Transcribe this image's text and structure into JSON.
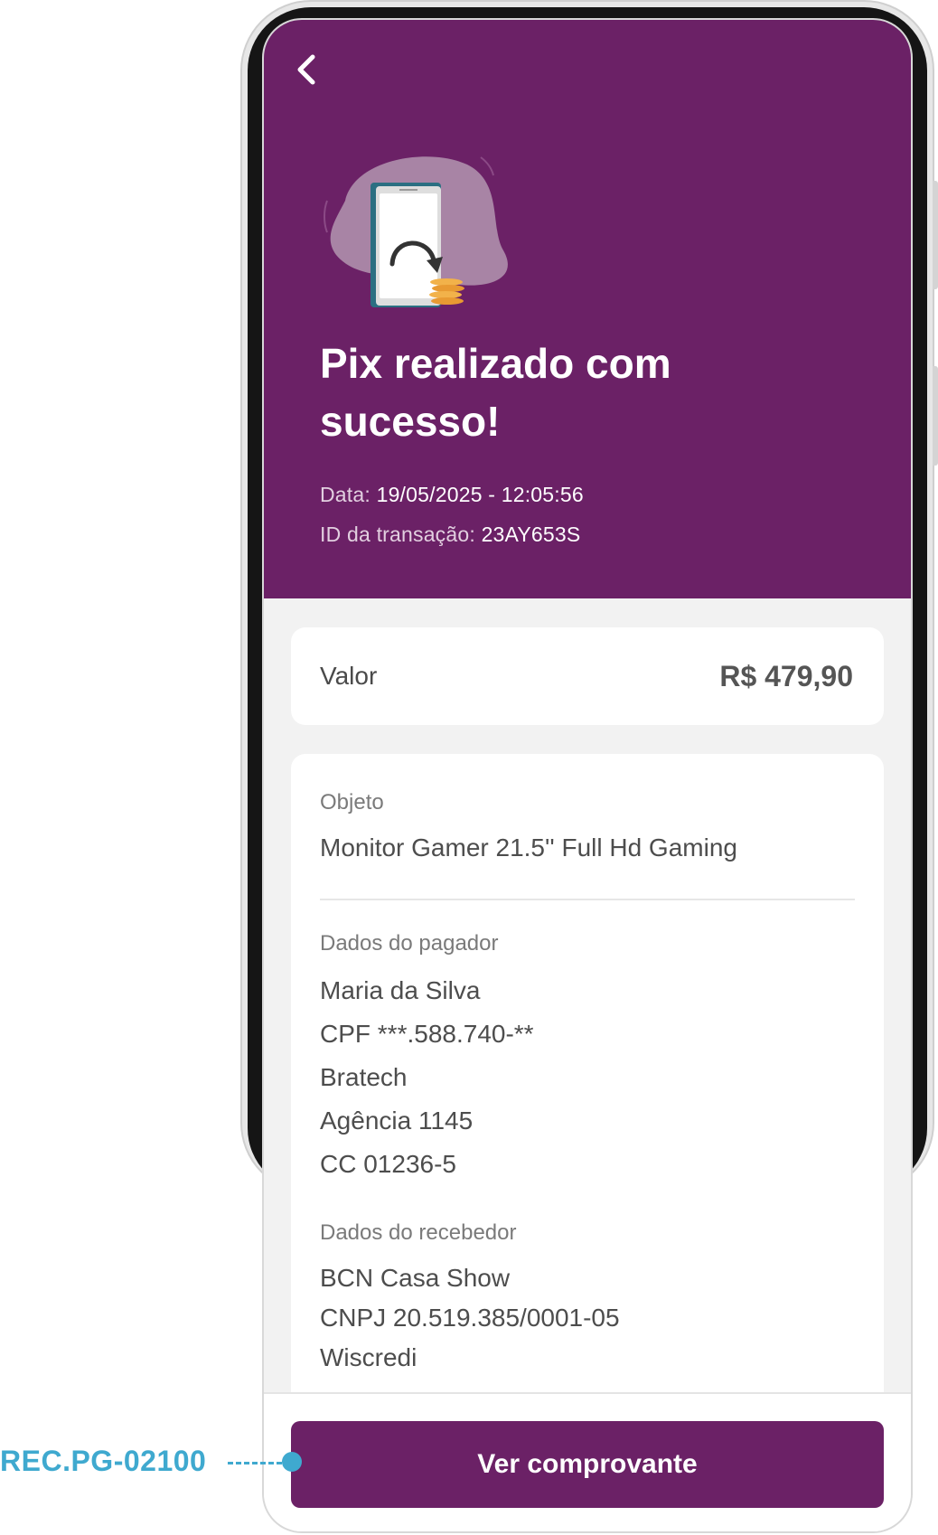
{
  "header": {
    "back_icon": "chevron-left-icon",
    "illustration_icon": "phone-transfer-coins-icon",
    "title": "Pix realizado com sucesso!",
    "date_label": "Data:",
    "date_value": "19/05/2025 - 12:05:56",
    "transaction_label": "ID da transação:",
    "transaction_value": "23AY653S"
  },
  "valor": {
    "label": "Valor",
    "amount": "R$ 479,90"
  },
  "details": {
    "object_label": "Objeto",
    "object_value": "Monitor Gamer 21.5'' Full Hd Gaming",
    "payer_label": "Dados do pagador",
    "payer_lines": [
      "Maria da Silva",
      "CPF ***.588.740-**",
      "Bratech",
      "Agência 1145",
      "CC 01236-5"
    ],
    "receiver_label": "Dados do recebedor",
    "receiver_lines": [
      "BCN Casa Show",
      "CNPJ 20.519.385/0001-05",
      "Wiscredi"
    ]
  },
  "footer": {
    "button_label": "Ver comprovante"
  },
  "annotation": {
    "code": "REC.PG-02100"
  },
  "colors": {
    "primary": "#6b2166",
    "annotation": "#3fa9cf",
    "background": "#f2f2f2"
  }
}
